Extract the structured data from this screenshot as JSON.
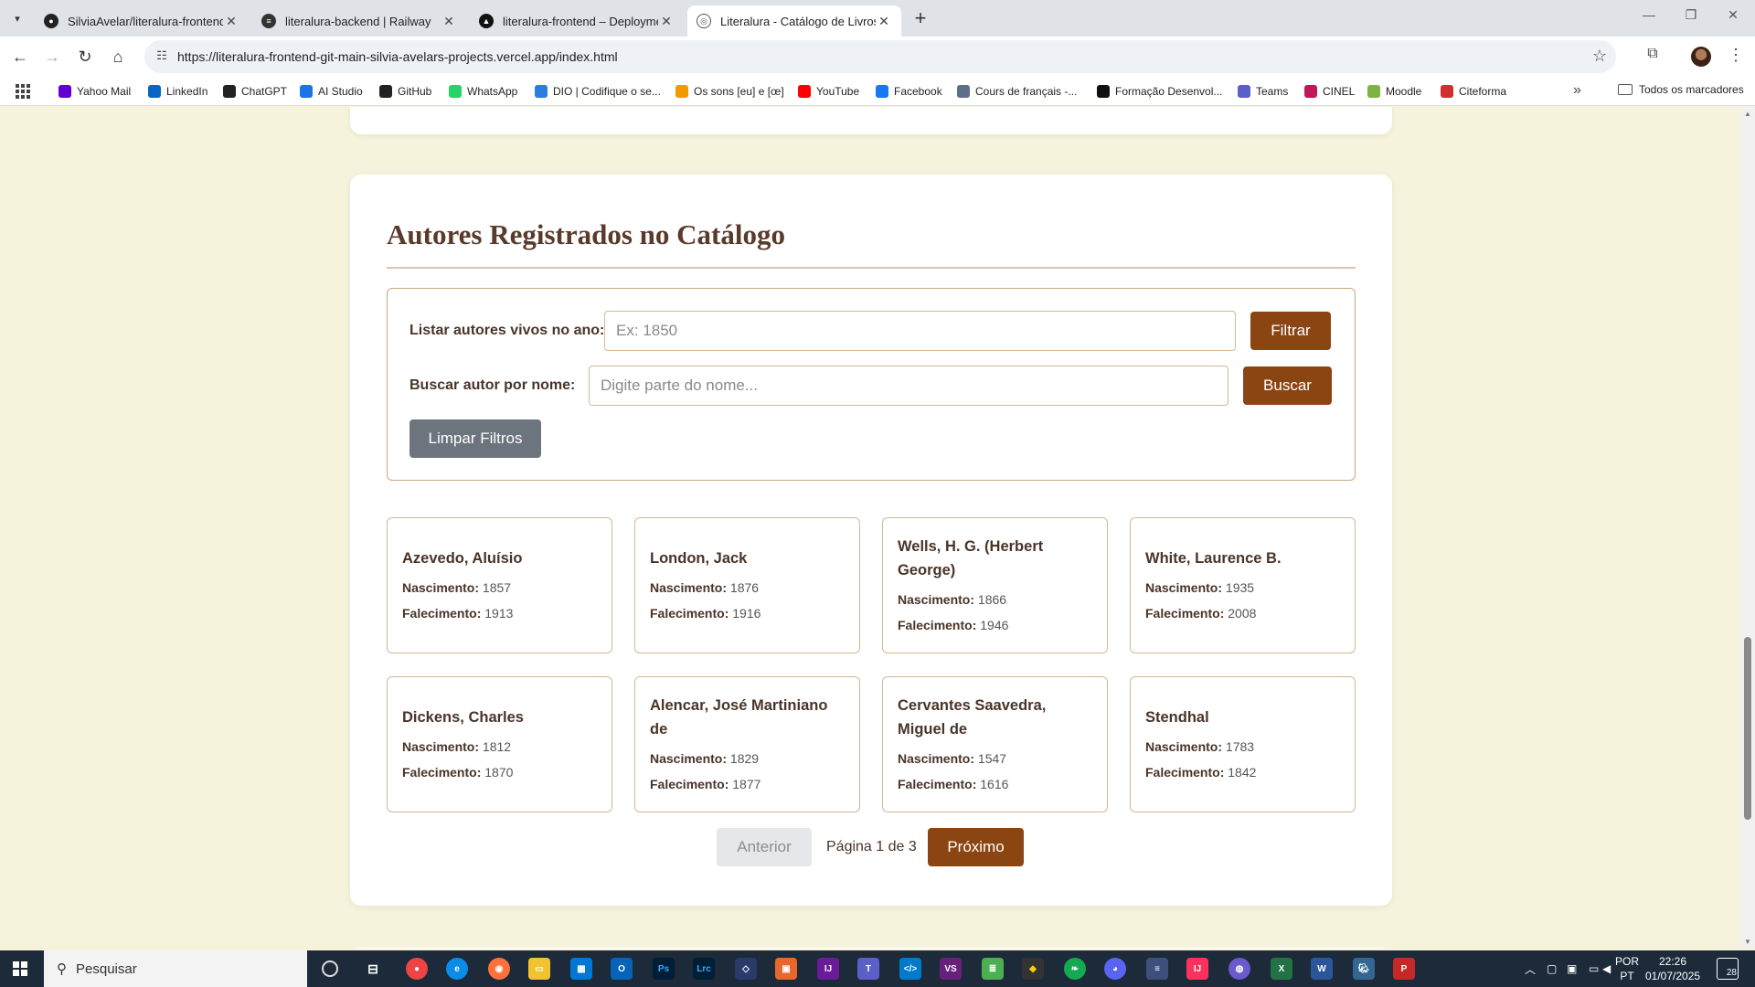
{
  "browser": {
    "tabs": [
      {
        "label": "SilviaAvelar/literalura-frontend",
        "icon": "github-icon",
        "active": false
      },
      {
        "label": "literalura-backend | Railway",
        "icon": "railway-icon",
        "active": false
      },
      {
        "label": "literalura-frontend – Deployme",
        "icon": "vercel-icon",
        "active": false
      },
      {
        "label": "Literalura - Catálogo de Livros",
        "icon": "globe-icon",
        "active": true
      }
    ],
    "url": "https://literalura-frontend-git-main-silvia-avelars-projects.vercel.app/index.html",
    "bookmarks": [
      {
        "label": "Yahoo Mail",
        "color": "#6001d2"
      },
      {
        "label": "LinkedIn",
        "color": "#0a66c2"
      },
      {
        "label": "ChatGPT",
        "color": "#222222"
      },
      {
        "label": "AI Studio",
        "color": "#1a73e8"
      },
      {
        "label": "GitHub",
        "color": "#222222"
      },
      {
        "label": "WhatsApp",
        "color": "#25d366"
      },
      {
        "label": "DIO | Codifique o se...",
        "color": "#2a7de1"
      },
      {
        "label": "Os sons [eu] e [œ]",
        "color": "#f29900"
      },
      {
        "label": "YouTube",
        "color": "#ff0000"
      },
      {
        "label": "Facebook",
        "color": "#1877f2"
      },
      {
        "label": "Cours de français -...",
        "color": "#5f6f8a"
      },
      {
        "label": "Formação Desenvol...",
        "color": "#111111"
      },
      {
        "label": "Teams",
        "color": "#5b5fc7"
      },
      {
        "label": "CINEL",
        "color": "#c2185b"
      },
      {
        "label": "Moodle",
        "color": "#7cb342"
      },
      {
        "label": "Citeforma",
        "color": "#d32f2f"
      }
    ],
    "all_bookmarks_label": "Todos os marcadores"
  },
  "page": {
    "section_title": "Autores Registrados no Catálogo",
    "filters": {
      "year_label": "Listar autores vivos no ano:",
      "year_placeholder": "Ex: 1850",
      "year_button": "Filtrar",
      "name_label": "Buscar autor por nome:",
      "name_placeholder": "Digite parte do nome...",
      "name_button": "Buscar",
      "clear_button": "Limpar Filtros"
    },
    "birth_label": "Nascimento:",
    "death_label": "Falecimento:",
    "authors": [
      {
        "name": "Azevedo, Aluísio",
        "birth": "1857",
        "death": "1913"
      },
      {
        "name": "London, Jack",
        "birth": "1876",
        "death": "1916"
      },
      {
        "name": "Wells, H. G. (Herbert George)",
        "birth": "1866",
        "death": "1946"
      },
      {
        "name": "White, Laurence B.",
        "birth": "1935",
        "death": "2008"
      },
      {
        "name": "Dickens, Charles",
        "birth": "1812",
        "death": "1870"
      },
      {
        "name": "Alencar, José Martiniano de",
        "birth": "1829",
        "death": "1877"
      },
      {
        "name": "Cervantes Saavedra, Miguel de",
        "birth": "1547",
        "death": "1616"
      },
      {
        "name": "Stendhal",
        "birth": "1783",
        "death": "1842"
      }
    ],
    "pagination": {
      "prev_label": "Anterior",
      "info": "Página 1 de 3",
      "next_label": "Próximo"
    }
  },
  "taskbar": {
    "search_placeholder": "Pesquisar",
    "lang_line1": "POR",
    "lang_line2": "PT",
    "time": "22:26",
    "date": "01/07/2025",
    "notification_count": "28"
  },
  "colors": {
    "page_bg": "#f5f3dc",
    "accent_brown": "#8b4513",
    "title_brown": "#5a3a2a"
  }
}
